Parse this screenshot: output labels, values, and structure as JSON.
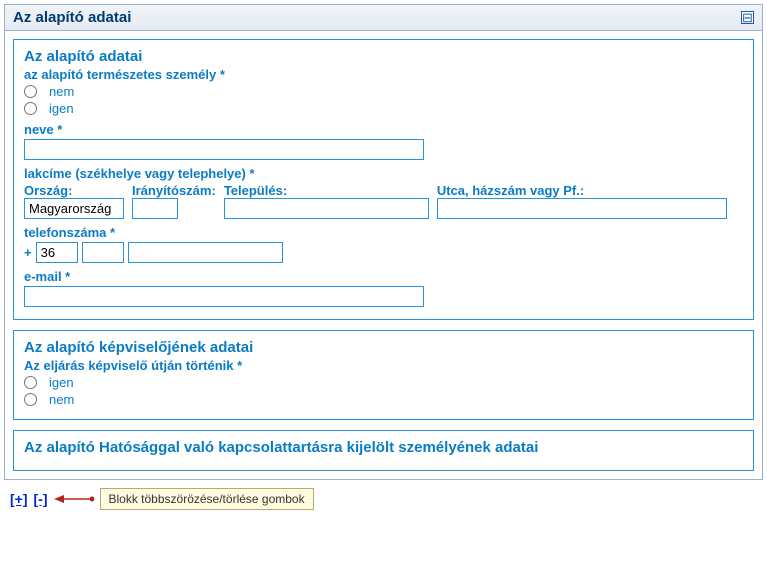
{
  "panel": {
    "title": "Az alapító adatai",
    "collapse_symbol": "⊟"
  },
  "section1": {
    "title": "Az alapító adatai",
    "natural_person_label": "az alapító természetes személy *",
    "radio_no": "nem",
    "radio_yes": "igen",
    "name_label": "neve *",
    "name_value": "",
    "address_label": "lakcíme (székhelye vagy telephelye) *",
    "country_label": "Ország:",
    "country_value": "Magyarország",
    "zip_label": "Irányítószám:",
    "zip_value": "",
    "city_label": "Település:",
    "city_value": "",
    "street_label": "Utca, házszám vagy Pf.:",
    "street_value": "",
    "phone_label": "telefonszáma *",
    "phone_plus": "+",
    "phone_country": "36",
    "phone_area": "",
    "phone_number": "",
    "email_label": "e-mail *",
    "email_value": ""
  },
  "section2": {
    "title": "Az alapító képviselőjének adatai",
    "rep_label": "Az eljárás képviselő útján történik *",
    "radio_yes": "igen",
    "radio_no": "nem"
  },
  "section3": {
    "title": "Az alapító Hatósággal való kapcsolattartásra kijelölt személyének adatai"
  },
  "footer": {
    "add_label": "[+]",
    "remove_label": "[-]",
    "tooltip": "Blokk többszörözése/törlése gombok"
  }
}
